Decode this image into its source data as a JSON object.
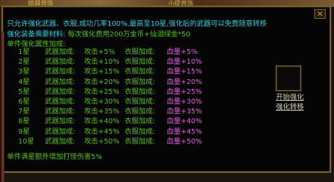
{
  "top_labels": [
    "暗器首饰",
    "小提首饰"
  ],
  "title": "只允许强化武器、衣服,成功几率100%,最高至10星,强化后的武器可以免费随意转移",
  "material_label": "强化装备需要材料:",
  "material_value": "每次强化费用200万金币+仙泪绿金*50",
  "attr_header": "单件强化属性加成:",
  "rows": [
    {
      "star": "1星",
      "weapon": "武器加成:",
      "atk": "攻击+5%",
      "armor": "衣服加成:",
      "hp": "血量+5%"
    },
    {
      "star": "2星",
      "weapon": "武器加成:",
      "atk": "攻击+10%",
      "armor": "衣服加成:",
      "hp": "血量+10%"
    },
    {
      "star": "3星",
      "weapon": "武器加成:",
      "atk": "攻击+15%",
      "armor": "衣服加成:",
      "hp": "血量+15%"
    },
    {
      "star": "4星",
      "weapon": "武器加成:",
      "atk": "攻击+20%",
      "armor": "衣服加成:",
      "hp": "血量+20%"
    },
    {
      "star": "5星",
      "weapon": "武器加成:",
      "atk": "攻击+25%",
      "armor": "衣服加成:",
      "hp": "血量+25%"
    },
    {
      "star": "6星",
      "weapon": "武器加成:",
      "atk": "攻击+30%",
      "armor": "衣服加成:",
      "hp": "血量+30%"
    },
    {
      "star": "7星",
      "weapon": "武器加成:",
      "atk": "攻击+35%",
      "armor": "衣服加成:",
      "hp": "血量+35%"
    },
    {
      "star": "8星",
      "weapon": "武器加成:",
      "atk": "攻击+40%",
      "armor": "衣服加成:",
      "hp": "血量+40%"
    },
    {
      "star": "9星",
      "weapon": "武器加成:",
      "atk": "攻击+45%",
      "armor": "衣服加成:",
      "hp": "血量+45%"
    },
    {
      "star": "10星",
      "weapon": "武器加成:",
      "atk": "攻击+50%",
      "armor": "衣服加成:",
      "hp": "血量+50%"
    }
  ],
  "footer": "单件满星额外增加打怪伤害5%",
  "buttons": {
    "start": "开始强化",
    "transfer": "强化转移"
  },
  "close_label": "×",
  "colors": {
    "cyan": "#26d0e0",
    "green": "#58c010",
    "pink": "#e060e0",
    "border": "#7a6030"
  }
}
